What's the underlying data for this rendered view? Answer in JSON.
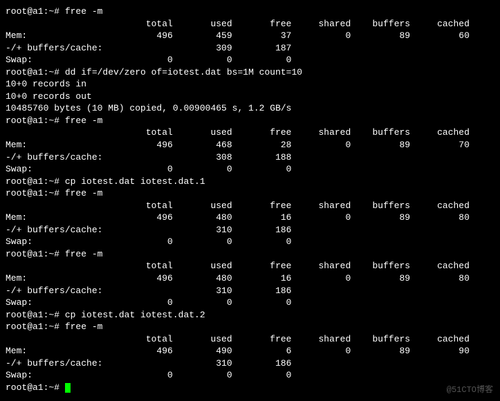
{
  "prompt": "root@a1:~#",
  "blocks": [
    {
      "type": "cmd",
      "cmd": "free -m"
    },
    {
      "type": "free",
      "header": [
        "total",
        "used",
        "free",
        "shared",
        "buffers",
        "cached"
      ],
      "mem_label": "Mem:",
      "mem": [
        496,
        459,
        37,
        0,
        89,
        60
      ],
      "bc_label": "-/+ buffers/cache:",
      "bc": [
        309,
        187
      ],
      "swap_label": "Swap:",
      "swap": [
        0,
        0,
        0
      ]
    },
    {
      "type": "cmd",
      "cmd": "dd if=/dev/zero of=iotest.dat bs=1M count=10"
    },
    {
      "type": "out",
      "lines": [
        "10+0 records in",
        "10+0 records out",
        "10485760 bytes (10 MB) copied, 0.00900465 s, 1.2 GB/s"
      ]
    },
    {
      "type": "cmd",
      "cmd": "free -m"
    },
    {
      "type": "free",
      "header": [
        "total",
        "used",
        "free",
        "shared",
        "buffers",
        "cached"
      ],
      "mem_label": "Mem:",
      "mem": [
        496,
        468,
        28,
        0,
        89,
        70
      ],
      "bc_label": "-/+ buffers/cache:",
      "bc": [
        308,
        188
      ],
      "swap_label": "Swap:",
      "swap": [
        0,
        0,
        0
      ]
    },
    {
      "type": "cmd",
      "cmd": "cp iotest.dat iotest.dat.1"
    },
    {
      "type": "cmd",
      "cmd": "free -m"
    },
    {
      "type": "free",
      "header": [
        "total",
        "used",
        "free",
        "shared",
        "buffers",
        "cached"
      ],
      "mem_label": "Mem:",
      "mem": [
        496,
        480,
        16,
        0,
        89,
        80
      ],
      "bc_label": "-/+ buffers/cache:",
      "bc": [
        310,
        186
      ],
      "swap_label": "Swap:",
      "swap": [
        0,
        0,
        0
      ]
    },
    {
      "type": "cmd",
      "cmd": "free -m"
    },
    {
      "type": "free",
      "header": [
        "total",
        "used",
        "free",
        "shared",
        "buffers",
        "cached"
      ],
      "mem_label": "Mem:",
      "mem": [
        496,
        480,
        16,
        0,
        89,
        80
      ],
      "bc_label": "-/+ buffers/cache:",
      "bc": [
        310,
        186
      ],
      "swap_label": "Swap:",
      "swap": [
        0,
        0,
        0
      ]
    },
    {
      "type": "cmd",
      "cmd": "cp iotest.dat iotest.dat.2"
    },
    {
      "type": "cmd",
      "cmd": "free -m"
    },
    {
      "type": "free",
      "header": [
        "total",
        "used",
        "free",
        "shared",
        "buffers",
        "cached"
      ],
      "mem_label": "Mem:",
      "mem": [
        496,
        490,
        6,
        0,
        89,
        90
      ],
      "bc_label": "-/+ buffers/cache:",
      "bc": [
        310,
        186
      ],
      "swap_label": "Swap:",
      "swap": [
        0,
        0,
        0
      ]
    },
    {
      "type": "prompt-cursor"
    }
  ],
  "watermark": "@51CTO博客"
}
